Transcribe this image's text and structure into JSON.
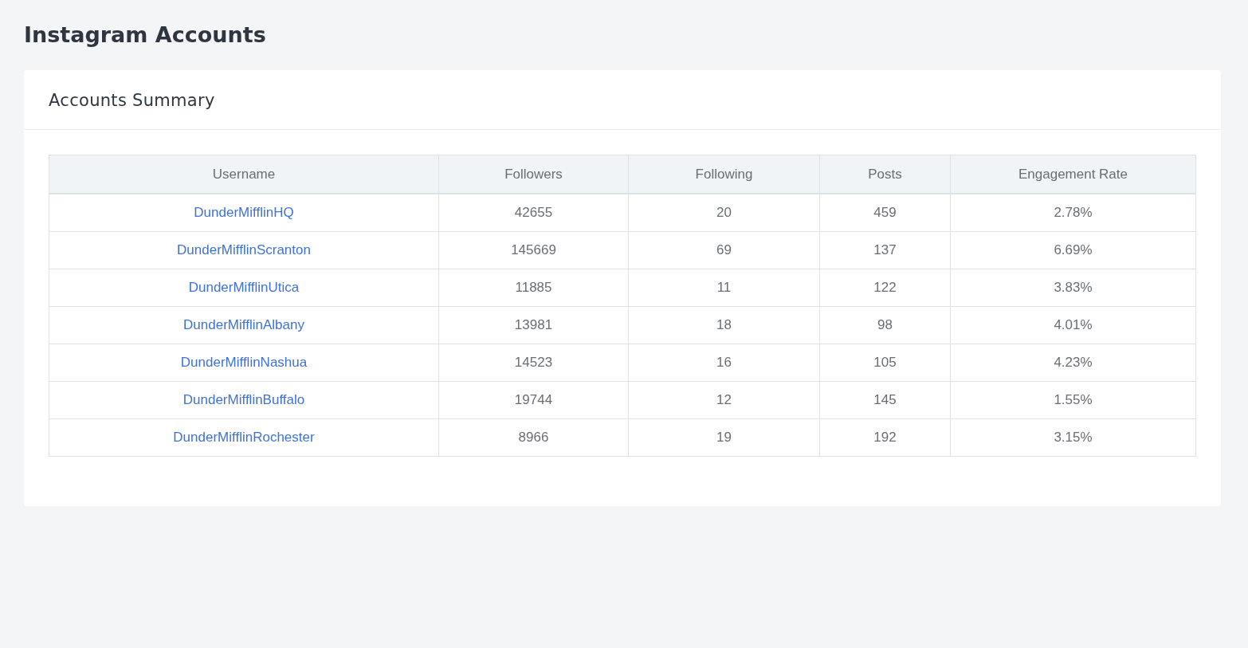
{
  "page": {
    "title": "Instagram Accounts"
  },
  "card": {
    "title": "Accounts Summary"
  },
  "table": {
    "columns": [
      "Username",
      "Followers",
      "Following",
      "Posts",
      "Engagement Rate"
    ],
    "rows": [
      {
        "username": "DunderMifflinHQ",
        "followers": "42655",
        "following": "20",
        "posts": "459",
        "engagement_rate": "2.78%"
      },
      {
        "username": "DunderMifflinScranton",
        "followers": "145669",
        "following": "69",
        "posts": "137",
        "engagement_rate": "6.69%"
      },
      {
        "username": "DunderMifflinUtica",
        "followers": "11885",
        "following": "11",
        "posts": "122",
        "engagement_rate": "3.83%"
      },
      {
        "username": "DunderMifflinAlbany",
        "followers": "13981",
        "following": "18",
        "posts": "98",
        "engagement_rate": "4.01%"
      },
      {
        "username": "DunderMifflinNashua",
        "followers": "14523",
        "following": "16",
        "posts": "105",
        "engagement_rate": "4.23%"
      },
      {
        "username": "DunderMifflinBuffalo",
        "followers": "19744",
        "following": "12",
        "posts": "145",
        "engagement_rate": "1.55%"
      },
      {
        "username": "DunderMifflinRochester",
        "followers": "8966",
        "following": "19",
        "posts": "192",
        "engagement_rate": "3.15%"
      }
    ]
  }
}
